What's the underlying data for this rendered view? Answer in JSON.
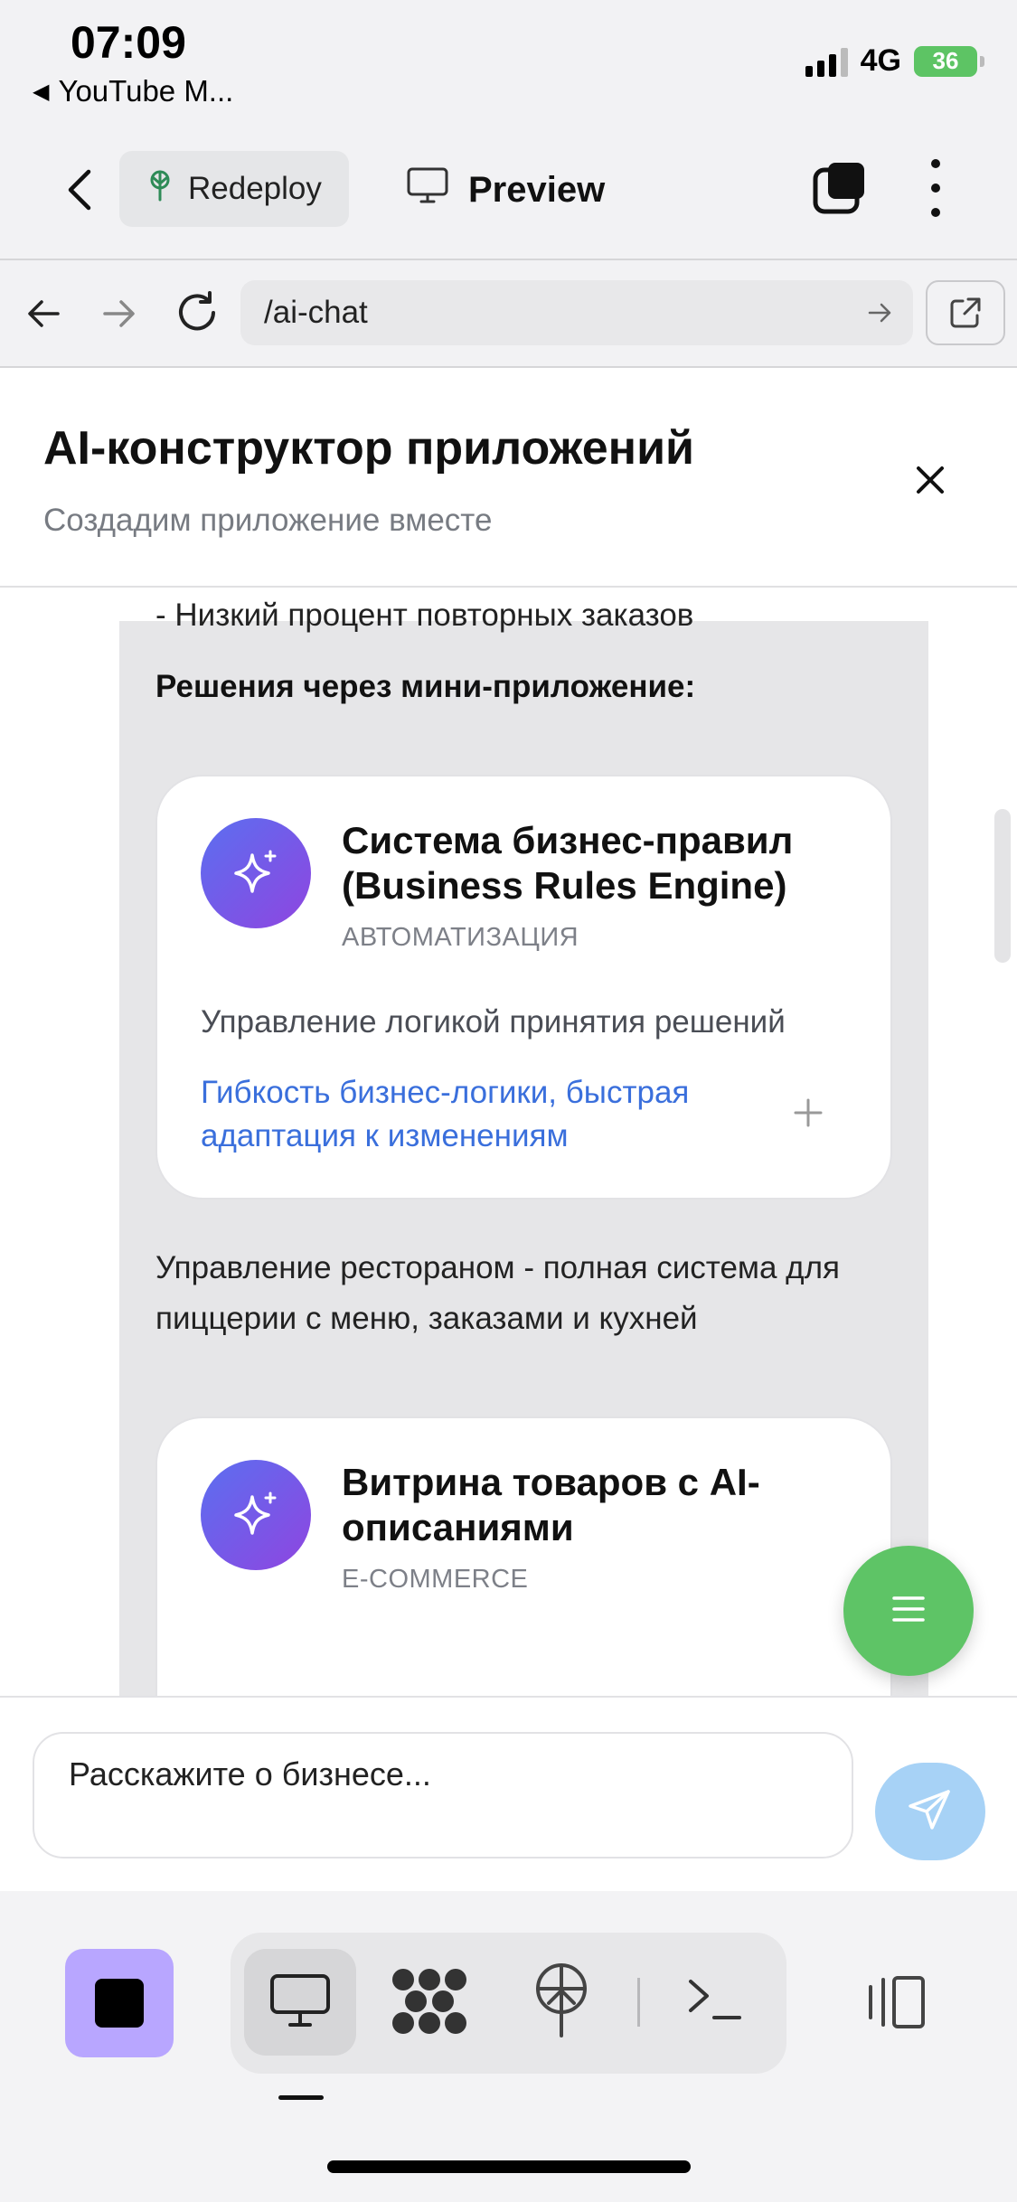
{
  "status_bar": {
    "time": "07:09",
    "back_app": "YouTube M...",
    "network": "4G",
    "battery": "36"
  },
  "toolbar": {
    "redeploy_label": "Redeploy",
    "preview_label": "Preview"
  },
  "browser": {
    "url": "/ai-chat"
  },
  "header": {
    "title": "AI-конструктор приложений",
    "subtitle": "Создадим приложение вместе"
  },
  "chat": {
    "text_top_partial": "- Низкий процент повторных заказов",
    "solutions_heading": "Решения через мини-приложение:",
    "card1": {
      "title": "Система бизнес-правил (Business Rules Engine)",
      "category": "АВТОМАТИЗАЦИЯ",
      "description": "Управление логикой принятия решений",
      "benefit": "Гибкость бизнес-логики, быстрая адаптация к изменениям"
    },
    "restaurant_text": " Управление рестораном - полная система для пиццерии с меню, заказами и кухней",
    "card2": {
      "title": "Витрина товаров с AI-описаниями",
      "category": "E-COMMERCE"
    }
  },
  "input": {
    "placeholder": "Расскажите о бизнесе..."
  },
  "icons": {
    "toolbar": [
      "chevron-left-icon",
      "tree-icon",
      "monitor-icon",
      "stack-icon",
      "more-vertical-icon"
    ],
    "browser": [
      "arrow-left-icon",
      "arrow-right-icon",
      "reload-icon",
      "arrow-right-small-icon",
      "external-link-icon"
    ],
    "bottom": [
      "stop-icon",
      "desktop-icon",
      "nodes-icon",
      "deploy-icon",
      "terminal-icon",
      "panels-icon"
    ]
  },
  "colors": {
    "accent_blue": "#3a6fdc",
    "fab_green": "#5ec466",
    "send_blue": "#a7d2f6",
    "stop_purple": "#b8a6ff",
    "icon_gradient_start": "#5b6ff0",
    "icon_gradient_end": "#8f45e0"
  }
}
